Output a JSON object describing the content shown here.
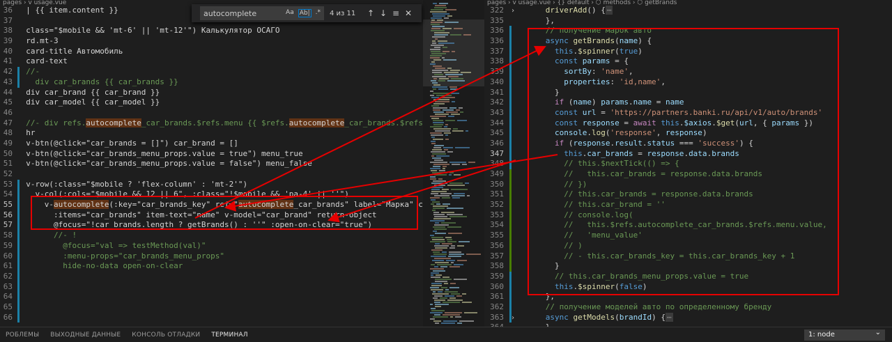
{
  "left": {
    "breadcrumb": "pages › 𝗏 usage.vue",
    "lines": [
      [
        [
          "t-text",
          "  | {{ item.content }}"
        ]
      ],
      [],
      [
        [
          "t-text",
          "  class=\"$mobile && 'mt-6' || 'mt-12'\") Калькулятор ОСАГО"
        ]
      ],
      [
        [
          "t-text",
          "  rd.mt-3"
        ]
      ],
      [
        [
          "t-text",
          "  card-title Автомобиль"
        ]
      ],
      [
        [
          "t-text",
          "  card-text"
        ]
      ],
      [
        [
          "t-com",
          "  //-"
        ]
      ],
      [
        [
          "t-com",
          "    div car_brands {{ car_brands }}"
        ]
      ],
      [
        [
          "t-text",
          "  div car_brand {{ car_brand }}"
        ]
      ],
      [
        [
          "t-text",
          "  div car_model {{ car_model }}"
        ]
      ],
      [],
      [
        [
          "t-com",
          "  //- div refs."
        ],
        [
          "hl",
          "autocomplete"
        ],
        [
          "t-com",
          "_car_brands.$refs.menu {{ $refs."
        ],
        [
          "hl",
          "autocomplete"
        ],
        [
          "t-com",
          "_car_brands.$refs.menu }}"
        ]
      ],
      [
        [
          "t-text",
          "  hr"
        ]
      ],
      [
        [
          "t-text",
          "  v-btn(@click=\"car_brands = []\") car_brand = []"
        ]
      ],
      [
        [
          "t-text",
          "  v-btn(@click=\"car_brands_menu_props.value = true\") menu_true"
        ]
      ],
      [
        [
          "t-text",
          "  v-btn(@click=\"car_brands_menu_props.value = false\") menu_false"
        ]
      ],
      [],
      [
        [
          "t-text",
          "  v-row(:class=\"$mobile ? 'flex-column' : 'mt-2'\")"
        ]
      ],
      [
        [
          "t-text",
          "    v-col(:cols=\"$mobile && 12 || 6\", :class=\"!$mobile && 'pa-4' || ''\")"
        ]
      ],
      [
        [
          "t-text",
          "      v-"
        ],
        [
          "hl",
          "autocomplete"
        ],
        [
          "t-text",
          "(:key=\"car_brands_key\" ref=\""
        ],
        [
          "hl",
          "autocomplete"
        ],
        [
          "t-text",
          "_car_brands\" label=\"Марка\" clearable"
        ]
      ],
      [
        [
          "t-text",
          "        :items=\"car_brands\" item-text=\"name\" v-model=\"car_brand\" return-object"
        ]
      ],
      [
        [
          "t-text",
          "        @focus=\"!car_brands.length ? getBrands() : ''\" :open-on-clear=\"true\")"
        ]
      ],
      [
        [
          "t-com",
          "        //- !"
        ]
      ],
      [
        [
          "t-com",
          "          @focus=\"val => testMethod(val)\""
        ]
      ],
      [
        [
          "t-com",
          "          :menu-props=\"car_brands_menu_props\""
        ]
      ],
      [
        [
          "t-com",
          "          hide-no-data open-on-clear"
        ]
      ]
    ],
    "line_numbers": [
      "36",
      "37",
      "38",
      "39",
      "40",
      "41",
      "42",
      "43",
      "44",
      "45",
      "46",
      "47",
      "48",
      "49",
      "50",
      "51",
      "52",
      "53",
      "54",
      "55",
      "56",
      "57",
      "58",
      "59",
      "60",
      "61",
      "62",
      "63",
      "64",
      "65",
      "66"
    ]
  },
  "find": {
    "query": "autocomplete",
    "opt_case": "Aa",
    "opt_word": "Ab|",
    "opt_regex": ".*",
    "count": "4 из 11",
    "up": "↑",
    "down": "↓",
    "selection": "≡",
    "close": "✕"
  },
  "right": {
    "breadcrumb": "pages › 𝗏 usage.vue › {} default › ⬡ methods › ⬡ getBrands",
    "lines": [
      {
        "n": "322",
        "fold": "›",
        "parts": [
          [
            "t-fn",
            "      driverAdd"
          ],
          [
            "t-text",
            "() {"
          ],
          [
            "ellipsis",
            "⋯"
          ]
        ]
      },
      {
        "n": "335",
        "fold": "",
        "parts": [
          [
            "t-text",
            "      },"
          ]
        ]
      },
      {
        "n": "336",
        "fold": "",
        "parts": [
          [
            "t-com",
            "      // получение марок авто"
          ]
        ]
      },
      {
        "n": "336",
        "fold": "",
        "parts": [
          [
            "t-kw",
            "      async "
          ],
          [
            "t-fn",
            "getBrands"
          ],
          [
            "t-text",
            "("
          ],
          [
            "t-var",
            "name"
          ],
          [
            "t-text",
            ") {"
          ]
        ]
      },
      {
        "n": "337",
        "fold": "",
        "parts": [
          [
            "t-kw",
            "        this"
          ],
          [
            "t-text",
            "."
          ],
          [
            "t-fn",
            "$spinner"
          ],
          [
            "t-text",
            "("
          ],
          [
            "t-kw",
            "true"
          ],
          [
            "t-text",
            ")"
          ]
        ]
      },
      {
        "n": "338",
        "fold": "",
        "parts": [
          [
            "t-kw",
            "        const "
          ],
          [
            "t-var",
            "params"
          ],
          [
            "t-text",
            " = {"
          ]
        ]
      },
      {
        "n": "339",
        "fold": "",
        "parts": [
          [
            "t-var",
            "          sortBy"
          ],
          [
            "t-text",
            ": "
          ],
          [
            "t-str",
            "'name'"
          ],
          [
            "t-text",
            ","
          ]
        ]
      },
      {
        "n": "340",
        "fold": "",
        "parts": [
          [
            "t-var",
            "          properties"
          ],
          [
            "t-text",
            ": "
          ],
          [
            "t-str",
            "'id,name'"
          ],
          [
            "t-text",
            ","
          ]
        ]
      },
      {
        "n": "341",
        "fold": "",
        "parts": [
          [
            "t-text",
            "        }"
          ]
        ]
      },
      {
        "n": "342",
        "fold": "",
        "parts": [
          [
            "t-ctrl",
            "        if "
          ],
          [
            "t-text",
            "("
          ],
          [
            "t-var",
            "name"
          ],
          [
            "t-text",
            ") "
          ],
          [
            "t-var",
            "params"
          ],
          [
            "t-text",
            "."
          ],
          [
            "t-var",
            "name"
          ],
          [
            "t-text",
            " = "
          ],
          [
            "t-var",
            "name"
          ]
        ]
      },
      {
        "n": "343",
        "fold": "",
        "parts": [
          [
            "t-kw",
            "        const "
          ],
          [
            "t-var",
            "url"
          ],
          [
            "t-text",
            " = "
          ],
          [
            "t-str",
            "'https://partners.banki.ru/api/v1/auto/brands'"
          ]
        ]
      },
      {
        "n": "344",
        "fold": "",
        "parts": [
          [
            "t-kw",
            "        const "
          ],
          [
            "t-var",
            "response"
          ],
          [
            "t-text",
            " = "
          ],
          [
            "t-ctrl",
            "await "
          ],
          [
            "t-kw",
            "this"
          ],
          [
            "t-text",
            "."
          ],
          [
            "t-var",
            "$axios"
          ],
          [
            "t-text",
            "."
          ],
          [
            "t-fn",
            "$get"
          ],
          [
            "t-text",
            "("
          ],
          [
            "t-var",
            "url"
          ],
          [
            "t-text",
            ", { "
          ],
          [
            "t-var",
            "params"
          ],
          [
            "t-text",
            " })"
          ]
        ]
      },
      {
        "n": "345",
        "fold": "",
        "parts": [
          [
            "t-var",
            "        console"
          ],
          [
            "t-text",
            "."
          ],
          [
            "t-fn",
            "log"
          ],
          [
            "t-text",
            "("
          ],
          [
            "t-str",
            "'response'"
          ],
          [
            "t-text",
            ", "
          ],
          [
            "t-var",
            "response"
          ],
          [
            "t-text",
            ")"
          ]
        ]
      },
      {
        "n": "346",
        "fold": "",
        "parts": [
          [
            "t-ctrl",
            "        if "
          ],
          [
            "t-text",
            "("
          ],
          [
            "t-var",
            "response"
          ],
          [
            "t-text",
            "."
          ],
          [
            "t-var",
            "result"
          ],
          [
            "t-text",
            "."
          ],
          [
            "t-var",
            "status"
          ],
          [
            "t-text",
            " === "
          ],
          [
            "t-str",
            "'success'"
          ],
          [
            "t-text",
            ") {"
          ]
        ]
      },
      {
        "n": "347",
        "fold": "",
        "parts": [
          [
            "t-kw",
            "          this"
          ],
          [
            "t-text",
            "."
          ],
          [
            "t-var",
            "car_brands"
          ],
          [
            "t-text",
            " = "
          ],
          [
            "t-var",
            "response"
          ],
          [
            "t-text",
            "."
          ],
          [
            "t-var",
            "data"
          ],
          [
            "t-text",
            "."
          ],
          [
            "t-var",
            "brands"
          ]
        ]
      },
      {
        "n": "348",
        "fold": "",
        "parts": [
          [
            "t-com",
            "          // this.$nextTick(() => {"
          ]
        ]
      },
      {
        "n": "349",
        "fold": "",
        "parts": [
          [
            "t-com",
            "          //   this.car_brands = response.data.brands"
          ]
        ]
      },
      {
        "n": "350",
        "fold": "",
        "parts": [
          [
            "t-com",
            "          // })"
          ]
        ]
      },
      {
        "n": "351",
        "fold": "",
        "parts": [
          [
            "t-com",
            "          // this.car_brands = response.data.brands"
          ]
        ]
      },
      {
        "n": "352",
        "fold": "",
        "parts": [
          [
            "t-com",
            "          // this.car_brand = ''"
          ]
        ]
      },
      {
        "n": "353",
        "fold": "",
        "parts": [
          [
            "t-com",
            "          // console.log("
          ]
        ]
      },
      {
        "n": "354",
        "fold": "",
        "parts": [
          [
            "t-com",
            "          //   this.$refs.autocomplete_car_brands.$refs.menu.value,"
          ]
        ]
      },
      {
        "n": "355",
        "fold": "",
        "parts": [
          [
            "t-com",
            "          //   'menu_value'"
          ]
        ]
      },
      {
        "n": "356",
        "fold": "",
        "parts": [
          [
            "t-com",
            "          // )"
          ]
        ]
      },
      {
        "n": "357",
        "fold": "",
        "parts": [
          [
            "t-com",
            "          // - this.car_brands_key = this.car_brands_key + 1"
          ]
        ]
      },
      {
        "n": "358",
        "fold": "",
        "parts": [
          [
            "t-text",
            "        }"
          ]
        ]
      },
      {
        "n": "359",
        "fold": "",
        "parts": [
          [
            "t-com",
            "        // this.car_brands_menu_props.value = true"
          ]
        ]
      },
      {
        "n": "360",
        "fold": "",
        "parts": [
          [
            "t-kw",
            "        this"
          ],
          [
            "t-text",
            "."
          ],
          [
            "t-fn",
            "$spinner"
          ],
          [
            "t-text",
            "("
          ],
          [
            "t-kw",
            "false"
          ],
          [
            "t-text",
            ")"
          ]
        ]
      },
      {
        "n": "361",
        "fold": "",
        "parts": [
          [
            "t-text",
            "      },"
          ]
        ]
      },
      {
        "n": "362",
        "fold": "",
        "parts": [
          [
            "t-com",
            "      // получение моделей авто по определенному бренду"
          ]
        ]
      },
      {
        "n": "363",
        "fold": "›",
        "parts": [
          [
            "t-kw",
            "      async "
          ],
          [
            "t-fn",
            "getModels"
          ],
          [
            "t-text",
            "("
          ],
          [
            "t-var",
            "brandId"
          ],
          [
            "t-text",
            ") {"
          ],
          [
            "ellipsis",
            "⋯"
          ]
        ]
      },
      {
        "n": "364",
        "fold": "",
        "parts": [
          [
            "t-text",
            "      }"
          ]
        ]
      }
    ]
  },
  "panel": {
    "tabs": [
      "РОБЛЕМЫ",
      "ВЫХОДНЫЕ ДАННЫЕ",
      "КОНСОЛЬ ОТЛАДКИ",
      "ТЕРМИНАЛ"
    ],
    "active_tab": "ТЕРМИНАЛ",
    "terminal_select": "1: node"
  },
  "colors": {
    "annotation": "#e60000",
    "editor_bg": "#1e1e1e"
  }
}
